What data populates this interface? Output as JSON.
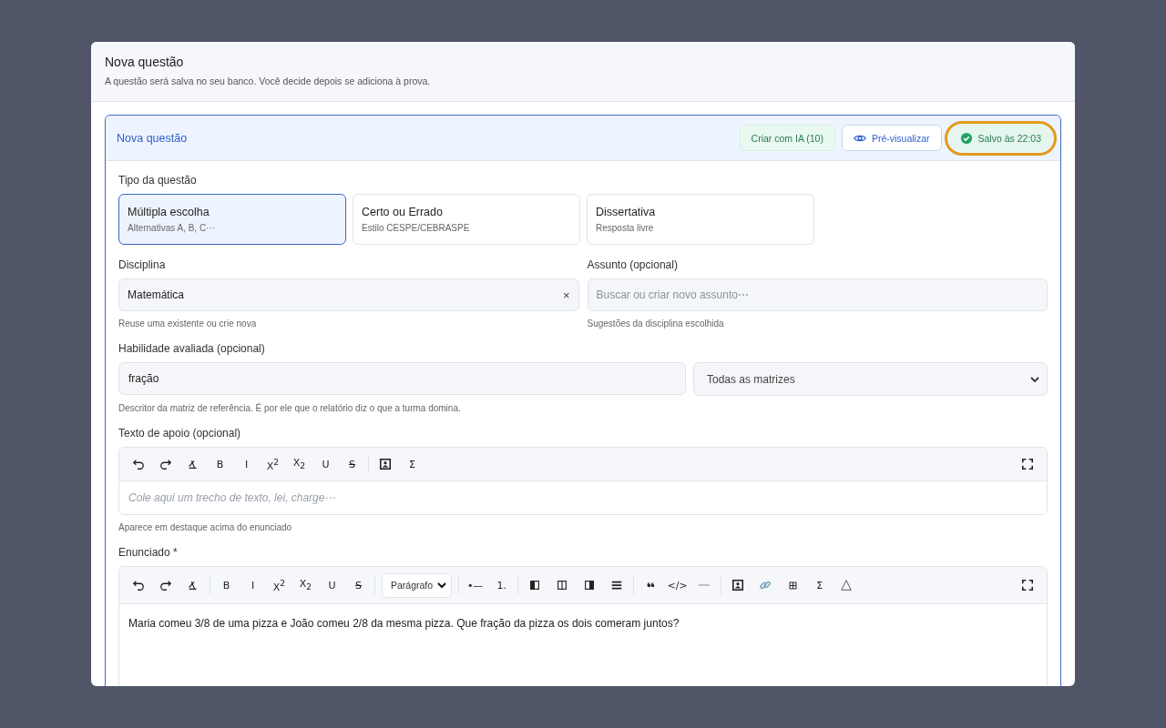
{
  "modal": {
    "title": "Nova questão",
    "subtitle": "A questão será salva no seu banco. Você decide depois se adiciona à prova."
  },
  "card": {
    "title": "Nova questão",
    "actions": [
      {
        "kind": "ai",
        "label": "Criar com IA (10)"
      },
      {
        "kind": "preview",
        "label": "Pré-visualizar"
      }
    ],
    "save_status": {
      "label": "Salvo às 22:03",
      "highlighted": true
    }
  },
  "question_type": {
    "label": "Tipo da questão",
    "options": [
      {
        "title": "Múltipla escolha",
        "subtitle": "Alternativas A, B, C⋯",
        "selected": true
      },
      {
        "title": "Certo ou Errado",
        "subtitle": "Estilo CESPE/CEBRASPE",
        "selected": false
      },
      {
        "title": "Dissertativa",
        "subtitle": "Resposta livre",
        "selected": false
      }
    ]
  },
  "discipline": {
    "label": "Disciplina",
    "value": "Matemática",
    "clear": "×",
    "hint": "Reuse uma existente ou crie nova"
  },
  "subject": {
    "label": "Assunto (opcional)",
    "placeholder": "Buscar ou criar novo assunto⋯",
    "hint": "Sugestões da disciplina escolhida"
  },
  "skill": {
    "label": "Habilidade avaliada (opcional)",
    "value": "fração",
    "matrix": "Todas as matrizes",
    "hint": "Descritor da matriz de referência. É por ele que o relatório diz o que a turma domina."
  },
  "support_text": {
    "label": "Texto de apoio (opcional)",
    "placeholder": "Cole aqui um trecho de texto, lei, charge⋯",
    "hint": "Aparece em destaque acima do enunciado",
    "toolbar": [
      {
        "kind": "undo"
      },
      {
        "kind": "redo"
      },
      {
        "kind": "clear"
      },
      {
        "kind": "text",
        "label": "B"
      },
      {
        "kind": "text",
        "label": "I"
      },
      {
        "kind": "text",
        "label": "X$^{2}$"
      },
      {
        "kind": "text",
        "label": "X$_{2}$"
      },
      {
        "kind": "text",
        "label": "U"
      },
      {
        "kind": "text",
        "label": "S"
      },
      {
        "kind": "separator"
      },
      {
        "kind": "image"
      },
      {
        "kind": "text",
        "label": "Σ"
      },
      {
        "kind": "fullscreen"
      }
    ]
  },
  "statement": {
    "label": "Enunciado *",
    "value": "Maria comeu 3/8 de uma pizza e João comeu 2/8 da mesma pizza. Que fração da pizza os dois comeram juntos?",
    "toolbar": [
      {
        "kind": "undo"
      },
      {
        "kind": "redo"
      },
      {
        "kind": "clear"
      },
      {
        "kind": "separator"
      },
      {
        "kind": "text",
        "label": "B"
      },
      {
        "kind": "text",
        "label": "I"
      },
      {
        "kind": "text",
        "label": "X$^{2}$"
      },
      {
        "kind": "text",
        "label": "X$_{2}$"
      },
      {
        "kind": "text",
        "label": "U"
      },
      {
        "kind": "text",
        "label": "S"
      },
      {
        "kind": "separator"
      },
      {
        "kind": "select",
        "label": "Parágrafo"
      },
      {
        "kind": "separator"
      },
      {
        "kind": "text",
        "label": "•—"
      },
      {
        "kind": "text",
        "label": "1."
      },
      {
        "kind": "separator"
      },
      {
        "kind": "align-left"
      },
      {
        "kind": "align-center"
      },
      {
        "kind": "align-right"
      },
      {
        "kind": "justify"
      },
      {
        "kind": "separator"
      },
      {
        "kind": "quote"
      },
      {
        "kind": "text",
        "label": "</>"
      },
      {
        "kind": "rule"
      },
      {
        "kind": "separator"
      },
      {
        "kind": "image"
      },
      {
        "kind": "link"
      },
      {
        "kind": "table"
      },
      {
        "kind": "text",
        "label": "Σ"
      },
      {
        "kind": "triangle"
      },
      {
        "kind": "fullscreen"
      }
    ]
  }
}
